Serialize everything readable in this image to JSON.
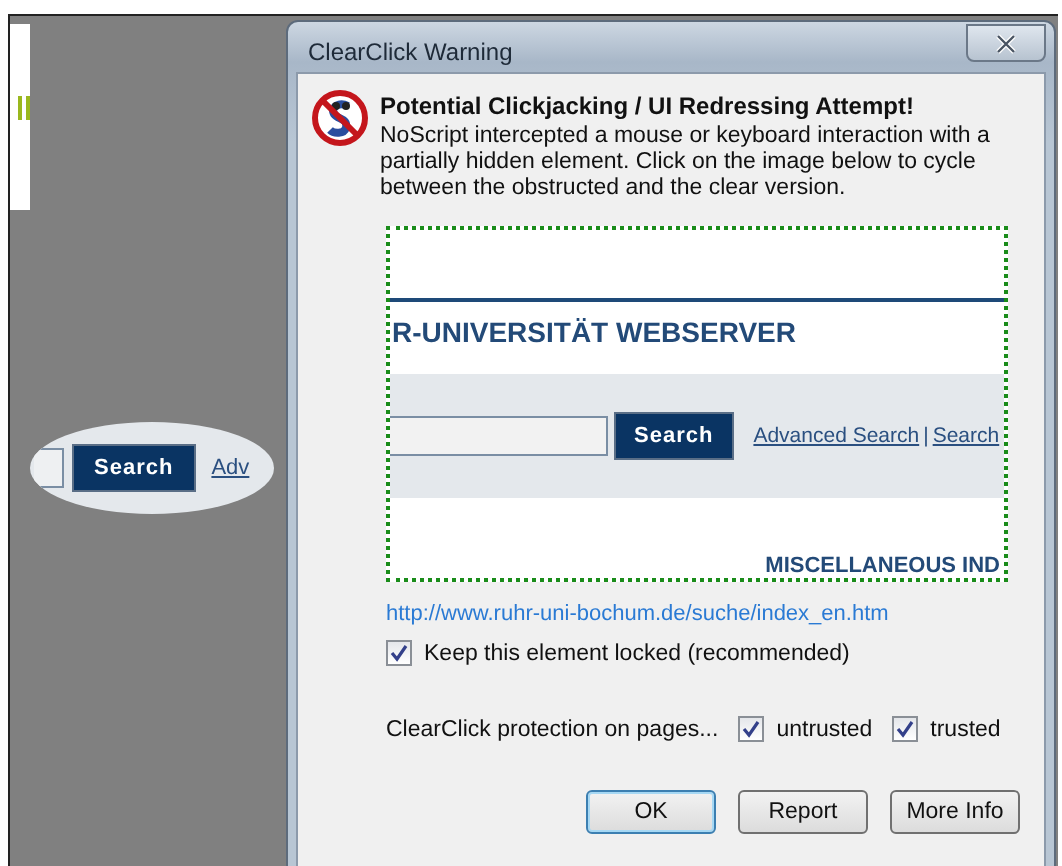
{
  "background_page": {
    "search_button": "Search",
    "link": "Adv"
  },
  "dialog": {
    "title": "ClearClick Warning",
    "heading": "Potential Clickjacking / UI Redressing Attempt!",
    "message": "NoScript intercepted a mouse or keyboard interaction with a partially hidden element. Click on the image below to cycle between the obstructed and the clear version.",
    "preview": {
      "site_title": "R-UNIVERSITÄT WEBSERVER",
      "search_button": "Search",
      "links": [
        "Advanced Search",
        "Search"
      ],
      "separator": "|",
      "section_heading": "MISCELLANEOUS IND"
    },
    "url": "http://www.ruhr-uni-bochum.de/suche/index_en.htm",
    "lock_option": {
      "label": "Keep this element locked (recommended)",
      "checked": true
    },
    "protection": {
      "label": "ClearClick protection on pages...",
      "options": [
        {
          "label": "untrusted",
          "checked": true
        },
        {
          "label": "trusted",
          "checked": true
        }
      ]
    },
    "buttons": [
      {
        "label": "OK",
        "default": true
      },
      {
        "label": "Report",
        "default": false
      },
      {
        "label": "More Info",
        "default": false
      }
    ]
  }
}
